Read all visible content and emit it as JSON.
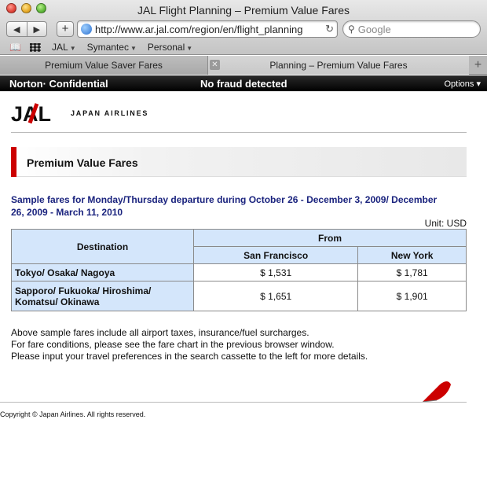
{
  "window": {
    "title": "JAL Flight Planning – Premium Value Fares"
  },
  "toolbar": {
    "back_icon": "back-arrow-icon",
    "forward_icon": "forward-arrow-icon",
    "add_label": "+",
    "url": "http://www.ar.jal.com/region/en/flight_planning",
    "search_placeholder": "Google"
  },
  "bookmarks": {
    "items": [
      "JAL",
      "Symantec",
      "Personal"
    ]
  },
  "tabs": [
    {
      "label": "Premium Value Saver Fares",
      "active": false
    },
    {
      "label": "Planning – Premium Value Fares",
      "active": true
    }
  ],
  "norton": {
    "brand": "Norton· Confidential",
    "status": "No fraud detected",
    "options": "Options"
  },
  "page": {
    "logo_text": "JAL",
    "airline_name": "JAPAN AIRLINES",
    "heading": "Premium Value Fares",
    "intro": "Sample fares for Monday/Thursday departure during October 26 - December 3, 2009/ December 26, 2009 - March 11, 2010",
    "unit": "Unit: USD",
    "table": {
      "destination_header": "Destination",
      "from_header": "From",
      "origins": [
        "San Francisco",
        "New York"
      ],
      "rows": [
        {
          "destination": "Tokyo/ Osaka/ Nagoya",
          "fares": [
            "$ 1,531",
            "$ 1,781"
          ]
        },
        {
          "destination": "Sapporo/ Fukuoka/ Hiroshima/ Komatsu/ Okinawa",
          "fares": [
            "$ 1,651",
            "$ 1,901"
          ]
        }
      ]
    },
    "notes": [
      "Above sample fares include all airport taxes, insurance/fuel surcharges.",
      "For fare conditions, please see the fare chart in the previous browser window.",
      "Please input your travel preferences in the search cassette to the left for more details."
    ],
    "copyright": "Copyright © Japan Airlines. All rights reserved."
  },
  "colors": {
    "accent_red": "#cc0000",
    "heading_blue": "#1a237e",
    "table_header_bg": "#d4e6fb"
  }
}
